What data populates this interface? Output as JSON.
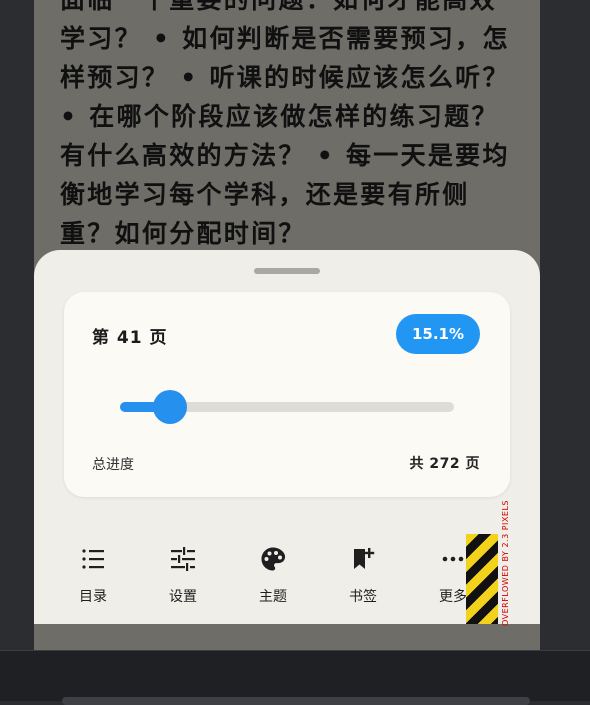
{
  "reader": {
    "content": "面临一个重要的问题：如何才能高效学习？ • 如何判断是否需要预习，怎样预习？ • 听课的时候应该怎么听？ • 在哪个阶段应该做怎样的练习题？有什么高效的方法？ • 每一天是要均衡地学习每个学科，还是要有所侧重？如何分配时间？"
  },
  "progress": {
    "page_label": "第 41 页",
    "percent": "15.1%",
    "percent_value": 15.1,
    "total_label": "总进度",
    "page_count": "共 272 页",
    "current_page": 41,
    "total_pages": 272
  },
  "toolbar": {
    "items": [
      {
        "label": "目录",
        "icon": "list-icon"
      },
      {
        "label": "设置",
        "icon": "sliders-icon"
      },
      {
        "label": "主题",
        "icon": "palette-icon"
      },
      {
        "label": "书签",
        "icon": "bookmark-add-icon"
      },
      {
        "label": "更多",
        "icon": "more-icon"
      }
    ]
  },
  "overflow_indicator": {
    "text": "OVERFLOWED BY 2.3 PIXELS"
  },
  "colors": {
    "accent": "#2196f3",
    "sheet": "#efeee9",
    "card": "#fbfaf5",
    "page_background": "#6e6d67",
    "app_background": "#2b2d31"
  }
}
